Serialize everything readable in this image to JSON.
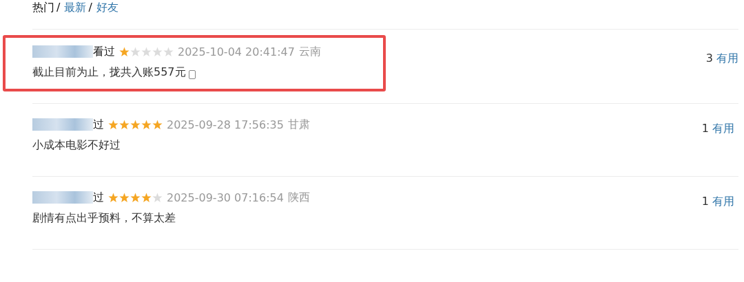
{
  "tabs": [
    {
      "label": "热门",
      "selected": true,
      "separator": "/"
    },
    {
      "label": "最新",
      "selected": false,
      "separator": "/"
    },
    {
      "label": "好友",
      "selected": false
    }
  ],
  "comments": [
    {
      "status": "看过",
      "stars": 1,
      "time": "2025-10-04 20:41:47",
      "region": "云南",
      "votes": "3",
      "vote_label": "有用",
      "text": "截止目前为止，拢共入账557元",
      "mobile": true,
      "highlighted": true
    },
    {
      "status": "过",
      "stars": 5,
      "time": "2025-09-28 17:56:35",
      "region": "甘肃",
      "votes": "1",
      "vote_label": "有用",
      "text": "小成本电影不好过",
      "mobile": false,
      "highlighted": false
    },
    {
      "status": "过",
      "stars": 4,
      "time": "2025-09-30 07:16:54",
      "region": "陕西",
      "votes": "1",
      "vote_label": "有用",
      "text": "剧情有点出乎预料，不算太差",
      "mobile": false,
      "highlighted": false
    }
  ]
}
